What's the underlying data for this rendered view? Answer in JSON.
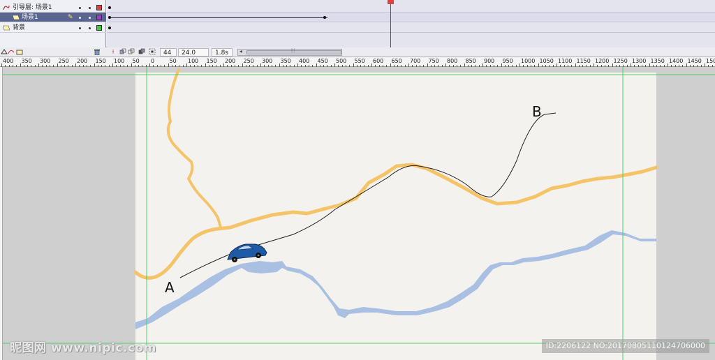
{
  "layers": [
    {
      "name": "引导层: 场景1",
      "type": "guide",
      "color": "#e04040",
      "selected": false
    },
    {
      "name": "场景1",
      "type": "guided",
      "color": "#9a3ec8",
      "selected": true
    },
    {
      "name": "背景",
      "type": "normal",
      "color": "#3ec83e",
      "selected": false
    }
  ],
  "timeline": {
    "current_frame": "44",
    "fps": "24.0 fps",
    "time": "1.8s"
  },
  "ruler": {
    "labels": [
      "400",
      "350",
      "300",
      "250",
      "200",
      "150",
      "100",
      "50",
      "0",
      "50",
      "100",
      "150",
      "200",
      "250",
      "300",
      "350",
      "400",
      "450",
      "500",
      "550",
      "600",
      "650",
      "700",
      "750",
      "800",
      "850",
      "900",
      "950",
      "1000",
      "1050",
      "1100",
      "1150",
      "1200",
      "1250",
      "1300",
      "1350",
      "1400",
      "1450",
      "150"
    ]
  },
  "stage": {
    "label_a": "A",
    "label_b": "B",
    "road_color": "#f5c468",
    "river_color": "#a9c0e2",
    "guide_color": "#4cd06a",
    "car_color": "#1f5aa6"
  },
  "watermark": {
    "left": "昵图网 www.nipic.com",
    "right": "ID:2206122 NO:20170805110124706000"
  }
}
